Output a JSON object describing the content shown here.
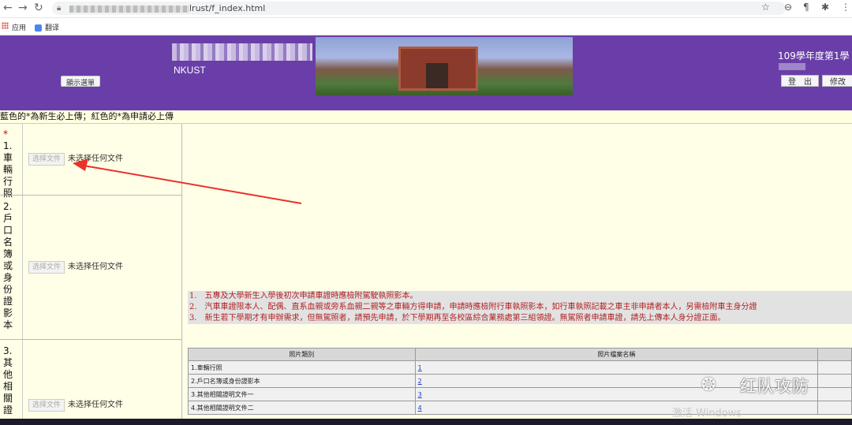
{
  "browser": {
    "url_visible": "lrust/f_index.html",
    "bookmarks": [
      {
        "label": "应用"
      },
      {
        "label": "翻译"
      }
    ]
  },
  "header": {
    "menu_button": "顯示選單",
    "school_en": "NKUST",
    "semester": "109學年度第1學",
    "logout_button": "登　出",
    "edit_button": "修改"
  },
  "notice": "藍色的*為新生必上傳；紅色的*為申請必上傳",
  "uploads": [
    {
      "required_mark": "*",
      "label": "1.車輛行照",
      "button": "选择文件",
      "status": "未选择任何文件"
    },
    {
      "required_mark": "",
      "label": "2.戶口名簿或身份證影本",
      "button": "选择文件",
      "status": "未选择任何文件"
    },
    {
      "required_mark": "",
      "label": "3.其他相關證",
      "button": "选择文件",
      "status": "未选择任何文件"
    }
  ],
  "instructions": [
    "1.　五專及大學新生入學後初次申請車證時應檢附駕駛執照影本。",
    "2.　汽車車證限本人、配偶、直系血親或旁系血親二親等之車輛方得申請，申請時應檢附行車執照影本，如行車執照記載之車主非申請者本人，另需檢附車主身分證",
    "3.　新生若下學期才有申辦需求，但無駕照者，請預先申請，於下學期再至各校區綜合業務處第三組領證。無駕照者申請車證，請先上傳本人身分證正面。"
  ],
  "table": {
    "headers": [
      "照片類別",
      "照片檔案名稱"
    ],
    "rows": [
      {
        "category": "1.車輛行照",
        "file": "1"
      },
      {
        "category": "2.戶口名簿或身份證影本",
        "file": "2"
      },
      {
        "category": "3.其他相關證明文件一",
        "file": "3"
      },
      {
        "category": "4.其他相關證明文件二",
        "file": "4"
      }
    ]
  },
  "watermark": "红队攻防",
  "os_overlay": "激活 Windows",
  "colors": {
    "banner": "#6a3ea8",
    "arrow": "#e8322c",
    "instruction_text": "#b22222"
  }
}
